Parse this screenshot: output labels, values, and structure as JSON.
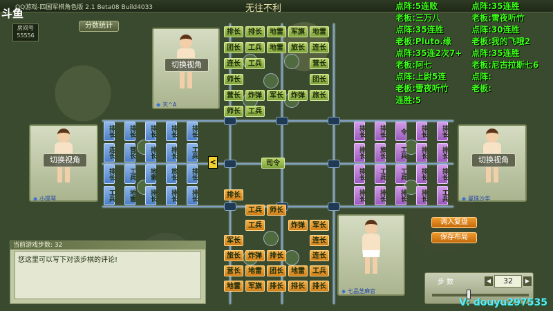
{
  "title": {
    "app": "QQ游戏-四国军棋角色版 2.1 Beta08 Build4033",
    "banner": "无往不利",
    "logo": "斗鱼"
  },
  "room": {
    "label": "房间号",
    "number": "55556"
  },
  "score_button": "分数统计",
  "players": {
    "top": {
      "name": "天^A",
      "view": "切换视角"
    },
    "left": {
      "name": "小提琴",
      "view": "切换视角"
    },
    "right": {
      "name": "曼珠沙华",
      "view": "切换视角"
    },
    "bottom": {
      "name": "七品芝麻官"
    }
  },
  "board": {
    "top_cells": [
      [
        "排长",
        "排长",
        "地雷",
        "军旗",
        "地雷"
      ],
      [
        "团长",
        "工兵",
        "地雷",
        "旅长",
        "连长"
      ],
      [
        "连长",
        "工兵",
        "",
        "",
        "营长"
      ],
      [
        "师长",
        "",
        "",
        "",
        "团长"
      ],
      [
        "营长",
        "炸弹",
        "军长",
        "炸弹",
        "旅长"
      ],
      [
        "师长",
        "工兵",
        "",
        "",
        ""
      ]
    ],
    "bottom_cells": [
      [
        "排长",
        "",
        "",
        "",
        ""
      ],
      [
        "",
        "工兵",
        "师长",
        "",
        ""
      ],
      [
        "",
        "工兵",
        "",
        "炸弹",
        "军长"
      ],
      [
        "军长",
        "",
        "",
        "",
        "连长"
      ],
      [
        "旅长",
        "炸弹",
        "排长",
        "",
        "连长"
      ],
      [
        "营长",
        "地雷",
        "团长",
        "地雷",
        "工兵"
      ],
      [
        "地雷",
        "军旗",
        "排长",
        "排长",
        "排长"
      ]
    ],
    "left_cells": [
      "排长",
      "排长",
      "排长",
      "排长",
      "排长",
      "连长",
      "营长",
      "排长",
      "排长",
      "工兵",
      "排长",
      "工兵",
      "地雷",
      "旅长",
      "排长",
      "工兵",
      "地雷",
      "排长",
      "排长",
      "排长"
    ],
    "right_cells": [
      "排长",
      "排长",
      "令",
      "排长",
      "排长",
      "排长",
      "旅长",
      "工兵",
      "排长",
      "排长",
      "排长",
      "工兵",
      "工兵",
      "排长",
      "排长",
      "排长",
      "排长",
      "排长",
      "排长",
      "工兵"
    ],
    "center": "司令",
    "marker": "<"
  },
  "moves": {
    "header": "当前游戏步数: 32",
    "comment_placeholder": "您这里可以写下对该步棋的评论!"
  },
  "actions": {
    "load": "调入复盘",
    "save": "保存布局"
  },
  "steps": {
    "label": "步 数",
    "value": "32"
  },
  "overlay": [
    {
      "t": "点阵:5连败"
    },
    {
      "t": "点阵:35连胜"
    },
    {
      "t": "老板:三万八"
    },
    {
      "t": "老板:雪夜听竹"
    },
    {
      "t": "点阵:35连胜"
    },
    {
      "t": "点阵:30连胜"
    },
    {
      "t": "老板:Pluto.缘"
    },
    {
      "t": "老板:我的飞哦2"
    },
    {
      "t": "点阵:35连2次7+"
    },
    {
      "t": "点阵:35连胜"
    },
    {
      "t": "老板:阿七"
    },
    {
      "t": "老板:尼古拉斯七6"
    },
    {
      "t": "点阵:上尉5连"
    },
    {
      "t": "点阵:"
    },
    {
      "t": "老板:雪夜听竹"
    },
    {
      "t": "老板:"
    },
    {
      "t": "连胜:5"
    }
  ],
  "watermark": "V: douyu297535"
}
